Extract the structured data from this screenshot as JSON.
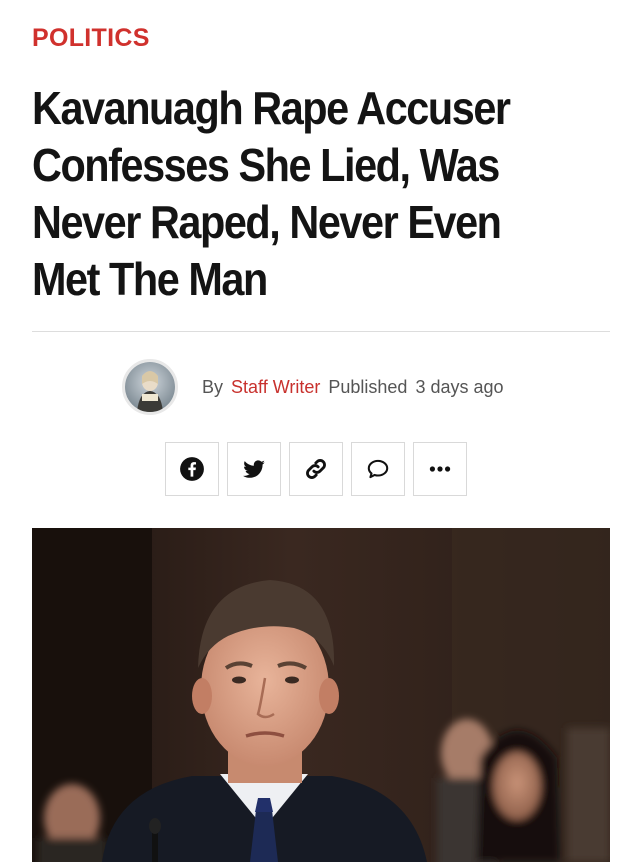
{
  "article": {
    "category": "POLITICS",
    "headline": "Kavanuagh Rape Accuser Confesses She Lied, Was Never Raped, Never Even Met The Man",
    "byline": {
      "by_label": "By",
      "author": "Staff Writer",
      "published_label": "Published",
      "time_ago": "3 days ago"
    }
  },
  "share_buttons": [
    {
      "icon": "facebook-icon"
    },
    {
      "icon": "twitter-icon"
    },
    {
      "icon": "link-icon"
    },
    {
      "icon": "comment-icon"
    },
    {
      "icon": "more-icon"
    }
  ],
  "colors": {
    "accent": "#d0312d",
    "headline": "#141414",
    "meta": "#555555"
  }
}
